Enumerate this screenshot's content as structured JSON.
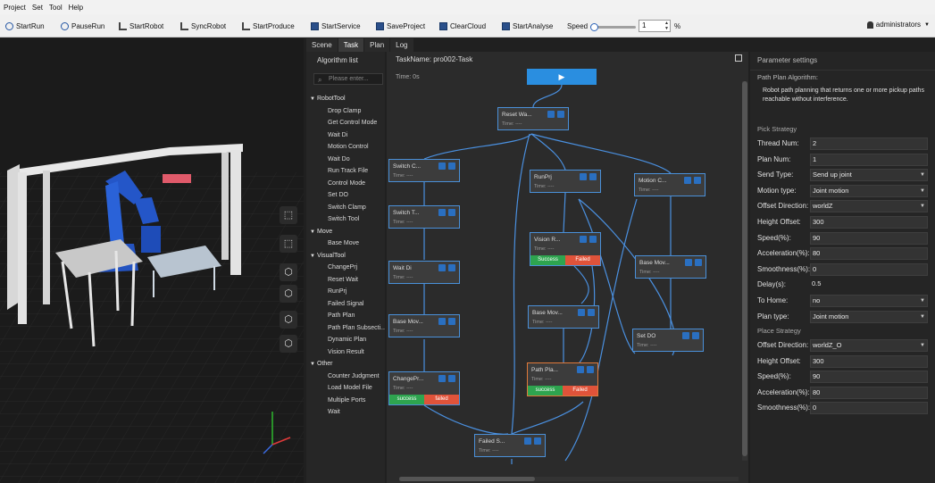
{
  "menu": [
    "Project",
    "Set",
    "Tool",
    "Help"
  ],
  "toolbar": {
    "buttons": [
      "StartRun",
      "PauseRun",
      "StartRobot",
      "SyncRobot",
      "StartProduce",
      "StartService",
      "SaveProject",
      "ClearCloud",
      "StartAnalyse"
    ],
    "speed_label": "Speed",
    "speed_value": "1",
    "speed_unit": "%",
    "speed_fraction": 0.05,
    "user": "administrators"
  },
  "tabs": [
    "Scene",
    "Task",
    "Plan",
    "Log"
  ],
  "algorithm_list": {
    "title": "Algorithm list",
    "search_placeholder": "Please enter...",
    "categories": [
      {
        "name": "RobotTool",
        "items": [
          "Drop Clamp",
          "Get Control Mode",
          "Wait Di",
          "Motion Control",
          "Wait Do",
          "Run Track File",
          "Control Mode",
          "Set DO",
          "Switch Clamp",
          "Switch Tool"
        ]
      },
      {
        "name": "Move",
        "items": [
          "Base Move"
        ]
      },
      {
        "name": "VisualTool",
        "items": [
          "ChangePrj",
          "Reset Wait",
          "RunPrj",
          "Failed Signal",
          "Path Plan",
          "Path Plan Subsecti...",
          "Dynamic Plan",
          "Vision Result"
        ]
      },
      {
        "name": "Other",
        "items": [
          "Counter Judgment",
          "Load Model File",
          "Multiple Ports",
          "Wait"
        ]
      }
    ]
  },
  "canvas": {
    "task_name": "TaskName: pro002-Task",
    "time": "Time: 0s",
    "node_time": "Time: ----",
    "start_icon": "▶",
    "success": "success",
    "success_cap": "Success",
    "failed": "Failed",
    "failed_lower": "failed",
    "nodes": {
      "reset": "Reset Wa...",
      "switch_c": "Switch C...",
      "switch_t": "Switch T...",
      "wait_di": "Wait Di",
      "base_mov_left": "Base Mov...",
      "change_pr": "ChangePr...",
      "runprj": "RunPrj",
      "vision_r": "Vision R...",
      "base_mov_mid": "Base Mov...",
      "path_pl": "Path Pla...",
      "motion_c": "Motion C...",
      "base_mov_right": "Base Mov...",
      "set_do": "Set DO",
      "failed_s": "Failed S..."
    }
  },
  "params": {
    "title": "Parameter settings",
    "algorithm_label": "Path Plan Algorithm:",
    "description": "Robot path planning that returns one or more pickup paths reachable without interference.",
    "pick_title": "Pick Strategy",
    "pick": [
      {
        "label": "Thread Num:",
        "value": "2",
        "type": "text"
      },
      {
        "label": "Plan Num:",
        "value": "1",
        "type": "text"
      },
      {
        "label": "Send Type:",
        "value": "Send up joint",
        "type": "select"
      },
      {
        "label": "Motion type:",
        "value": "Joint motion",
        "type": "select"
      },
      {
        "label": "Offset Direction:",
        "value": "worldZ",
        "type": "select"
      },
      {
        "label": "Height Offset:",
        "value": "300",
        "type": "text"
      },
      {
        "label": "Speed(%):",
        "value": "90",
        "type": "text"
      },
      {
        "label": "Acceleration(%):",
        "value": "80",
        "type": "text"
      },
      {
        "label": "Smoothness(%):",
        "value": "0",
        "type": "text"
      },
      {
        "label": "Delay(s):",
        "value": "0.5",
        "type": "plain"
      },
      {
        "label": "To Home:",
        "value": "no",
        "type": "select"
      },
      {
        "label": "Plan type:",
        "value": "Joint motion",
        "type": "select"
      }
    ],
    "place_title": "Place Strategy",
    "place": [
      {
        "label": "Offset Direction:",
        "value": "worldZ_O",
        "type": "select"
      },
      {
        "label": "Height Offset:",
        "value": "300",
        "type": "text"
      },
      {
        "label": "Speed(%):",
        "value": "90",
        "type": "text"
      },
      {
        "label": "Acceleration(%):",
        "value": "80",
        "type": "text"
      },
      {
        "label": "Smoothness(%):",
        "value": "0",
        "type": "text"
      }
    ]
  }
}
